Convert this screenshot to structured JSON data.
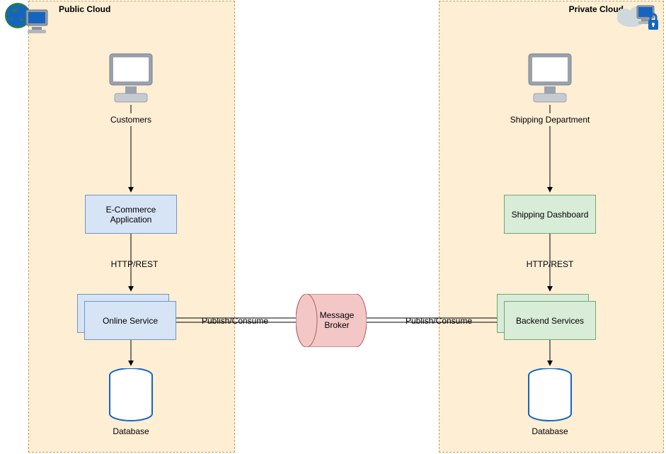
{
  "left_cloud": {
    "title": "Public Cloud"
  },
  "right_cloud": {
    "title": "Private Cloud"
  },
  "left": {
    "client_label": "Customers",
    "app_label": "E-Commerce Application",
    "app_to_service": "HTTP/REST",
    "service_label": "Online Service",
    "db_label": "Database"
  },
  "right": {
    "client_label": "Shipping Department",
    "app_label": "Shipping Dashboard",
    "app_to_service": "HTTP/REST",
    "service_label": "Backend Services",
    "db_label": "Database"
  },
  "center": {
    "broker_label": "Message Broker",
    "left_link": "Publish/Consume",
    "right_link": "Publish/Consume"
  },
  "icons": {
    "globe_pc": "globe-computer-icon",
    "cloud_lock": "cloud-lock-icon",
    "computer": "computer-icon",
    "database": "database-icon",
    "cylinder": "message-broker-icon"
  }
}
